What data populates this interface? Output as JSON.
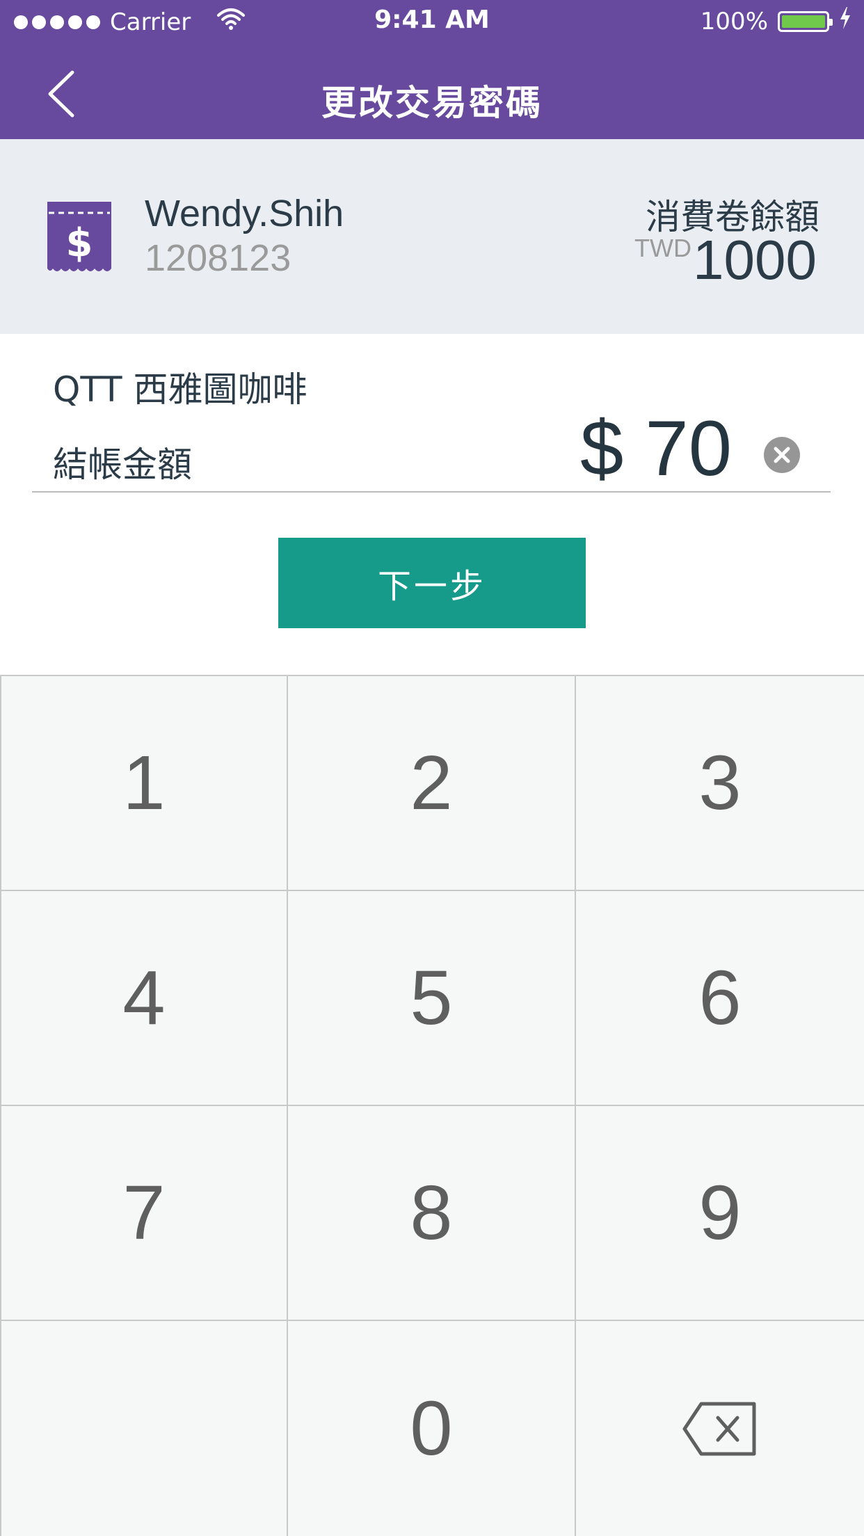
{
  "status_bar": {
    "carrier": "Carrier",
    "time": "9:41 AM",
    "battery": "100%",
    "battery_level": 1.0,
    "battery_color": "#71c94b",
    "signal_icon": "signal-dots-icon",
    "wifi_icon": "wifi-icon",
    "charging_icon": "lightning-bolt-icon"
  },
  "navbar": {
    "title": "更改交易密碼",
    "back_icon": "chevron-left-icon",
    "background": "#674a9e"
  },
  "account": {
    "icon": "dollar-voucher-icon",
    "name": "Wendy.Shih",
    "id": "1208123",
    "balance_label": "消費卷餘額",
    "currency": "TWD",
    "balance": "1000"
  },
  "checkout": {
    "merchant": "QTT 西雅圖咖啡",
    "label": "結帳金額",
    "amount": "$ 70",
    "clear_icon": "clear-circle-icon"
  },
  "next_button": {
    "label": "下一步",
    "color": "#169b8b"
  },
  "keypad": {
    "keys": [
      "1",
      "2",
      "3",
      "4",
      "5",
      "6",
      "7",
      "8",
      "9",
      "",
      "0",
      ""
    ],
    "backspace_icon": "backspace-icon"
  }
}
